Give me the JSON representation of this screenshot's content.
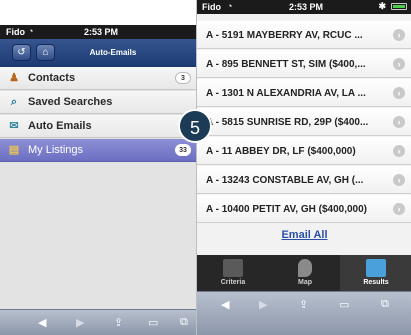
{
  "back": {
    "status": {
      "carrier": "Fido",
      "time": "2:53 PM"
    },
    "header": {
      "title": "Auto-Emails"
    },
    "menu": [
      {
        "label": "Contacts",
        "count": "3"
      },
      {
        "label": "Saved Searches",
        "count": ""
      },
      {
        "label": "Auto Emails",
        "count": ""
      },
      {
        "label": "My Listings",
        "count": "33"
      }
    ]
  },
  "front": {
    "status": {
      "carrier": "Fido",
      "time": "2:53 PM"
    },
    "listings": [
      "A - 5191 MAYBERRY AV, RCUC ...",
      "A - 895 BENNETT ST, SIM ($400,...",
      "A - 1301 N ALEXANDRIA AV, LA ...",
      "A - 5815 SUNRISE RD, 29P ($400...",
      "A - 11 ABBEY DR, LF ($400,000)",
      "A - 13243 CONSTABLE AV, GH (...",
      "A - 10400 PETIT AV, GH ($400,000)"
    ],
    "email_all": "Email All",
    "tabs": [
      "Criteria",
      "Map",
      "Results"
    ]
  },
  "step_badge": "5",
  "colors": {
    "header": "#1c3a72",
    "active": "#6c6fc2",
    "badge": "#1c3b56",
    "link": "#2a4fa8"
  }
}
